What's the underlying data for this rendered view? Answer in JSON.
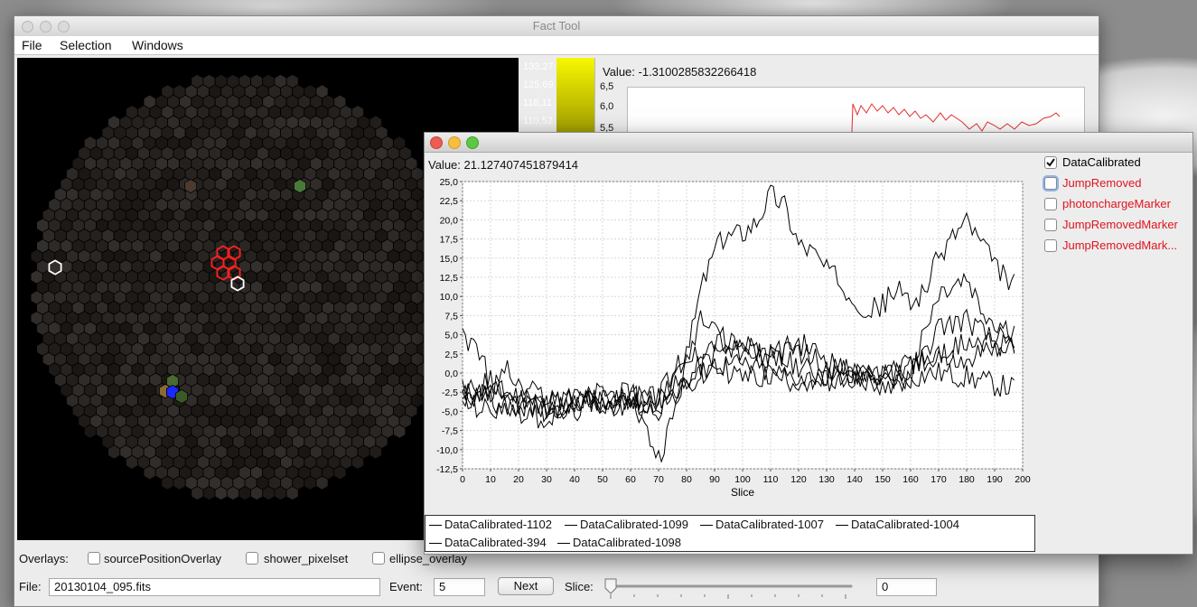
{
  "main_window": {
    "title": "Fact Tool",
    "menu": [
      "File",
      "Selection",
      "Windows"
    ],
    "color_scale_labels": [
      "133,27",
      "125,69",
      "118,11",
      "110,52"
    ],
    "value_label": "Value: -1.3100285832266418",
    "bg_plot_yticks": [
      "6,5",
      "6,0",
      "5,5"
    ],
    "overlays_label": "Overlays:",
    "overlays": [
      {
        "label": "sourcePositionOverlay",
        "checked": false
      },
      {
        "label": "shower_pixelset",
        "checked": false
      },
      {
        "label": "ellipse_overlay",
        "checked": false
      }
    ],
    "file_label": "File:",
    "file_value": "20130104_095.fits",
    "event_label": "Event:",
    "event_value": "5",
    "next_label": "Next",
    "slice_label": "Slice:",
    "slice_value": "0"
  },
  "plot_window": {
    "value_label": "Value: 21.127407451879414",
    "series_toggles": [
      {
        "label": "DataCalibrated",
        "checked": true,
        "color": "#000000"
      },
      {
        "label": "JumpRemoved",
        "checked": false,
        "color": "#e0141e"
      },
      {
        "label": "photonchargeMarker",
        "checked": false,
        "color": "#e0141e"
      },
      {
        "label": "JumpRemovedMarker",
        "checked": false,
        "color": "#e0141e"
      },
      {
        "label": "JumpRemovedMark...",
        "checked": false,
        "color": "#e0141e"
      }
    ]
  },
  "chart_data": {
    "type": "line",
    "xlabel": "Slice",
    "ylabel": "",
    "xlim": [
      0,
      200
    ],
    "ylim": [
      -12.5,
      25
    ],
    "xticks": [
      0,
      10,
      20,
      30,
      40,
      50,
      60,
      70,
      80,
      90,
      100,
      110,
      120,
      130,
      140,
      150,
      160,
      170,
      180,
      190,
      200
    ],
    "yticks": [
      "25,0",
      "22,5",
      "20,0",
      "17,5",
      "15,0",
      "12,5",
      "10,0",
      "7,5",
      "5,0",
      "2,5",
      "0,0",
      "-2,5",
      "-5,0",
      "-7,5",
      "-10,0",
      "-12,5"
    ],
    "grid": true,
    "legend_position": "bottom",
    "series": [
      {
        "name": "DataCalibrated-1102",
        "anchors": [
          [
            0,
            -3
          ],
          [
            10,
            -2.5
          ],
          [
            20,
            -3
          ],
          [
            30,
            -4
          ],
          [
            40,
            -3
          ],
          [
            50,
            -4
          ],
          [
            60,
            -3
          ],
          [
            70,
            -3.5
          ],
          [
            75,
            -2
          ],
          [
            80,
            -1
          ],
          [
            85,
            1
          ],
          [
            90,
            2.5
          ],
          [
            100,
            3
          ],
          [
            110,
            2
          ],
          [
            120,
            1
          ],
          [
            130,
            -0.5
          ],
          [
            140,
            -1
          ],
          [
            150,
            -1.5
          ],
          [
            160,
            -0.5
          ],
          [
            170,
            0
          ],
          [
            180,
            -0.5
          ],
          [
            190,
            -1.5
          ],
          [
            197,
            -2
          ]
        ]
      },
      {
        "name": "DataCalibrated-1099",
        "anchors": [
          [
            0,
            -3
          ],
          [
            10,
            -1
          ],
          [
            20,
            -3.5
          ],
          [
            30,
            -4
          ],
          [
            40,
            -4
          ],
          [
            50,
            -2.5
          ],
          [
            60,
            -3
          ],
          [
            70,
            -11
          ],
          [
            75,
            -6
          ],
          [
            80,
            1
          ],
          [
            85,
            8
          ],
          [
            90,
            7
          ],
          [
            95,
            3
          ],
          [
            100,
            4
          ],
          [
            110,
            2.5
          ],
          [
            120,
            4
          ],
          [
            130,
            2
          ],
          [
            140,
            -1
          ],
          [
            150,
            -1.5
          ],
          [
            160,
            -1
          ],
          [
            170,
            6
          ],
          [
            180,
            7
          ],
          [
            190,
            4
          ],
          [
            197,
            3
          ]
        ]
      },
      {
        "name": "DataCalibrated-1007",
        "anchors": [
          [
            0,
            5
          ],
          [
            5,
            3
          ],
          [
            10,
            -1
          ],
          [
            20,
            -4
          ],
          [
            30,
            -5
          ],
          [
            40,
            -3.5
          ],
          [
            50,
            -4
          ],
          [
            60,
            -4
          ],
          [
            70,
            -3.5
          ],
          [
            80,
            -1.5
          ],
          [
            90,
            1
          ],
          [
            100,
            1
          ],
          [
            110,
            0
          ],
          [
            120,
            -0.5
          ],
          [
            130,
            -1
          ],
          [
            140,
            -0.5
          ],
          [
            150,
            0
          ],
          [
            160,
            1
          ],
          [
            170,
            2.5
          ],
          [
            180,
            1
          ],
          [
            190,
            5
          ],
          [
            197,
            3.5
          ]
        ]
      },
      {
        "name": "DataCalibrated-1004",
        "anchors": [
          [
            0,
            -4
          ],
          [
            10,
            -5
          ],
          [
            20,
            -4
          ],
          [
            30,
            -5
          ],
          [
            40,
            -3.5
          ],
          [
            50,
            -4
          ],
          [
            60,
            -4
          ],
          [
            70,
            -5
          ],
          [
            75,
            -1
          ],
          [
            80,
            1
          ],
          [
            85,
            3
          ],
          [
            90,
            4
          ],
          [
            100,
            3.5
          ],
          [
            110,
            2
          ],
          [
            120,
            3
          ],
          [
            130,
            1
          ],
          [
            140,
            0
          ],
          [
            150,
            -0.5
          ],
          [
            160,
            0
          ],
          [
            170,
            10
          ],
          [
            180,
            12
          ],
          [
            185,
            8
          ],
          [
            190,
            6
          ],
          [
            197,
            5
          ]
        ]
      },
      {
        "name": "DataCalibrated-394",
        "anchors": [
          [
            0,
            -1
          ],
          [
            10,
            -3.5
          ],
          [
            20,
            -5
          ],
          [
            30,
            -6
          ],
          [
            40,
            -5
          ],
          [
            50,
            -4
          ],
          [
            60,
            -4
          ],
          [
            70,
            -4
          ],
          [
            80,
            -2
          ],
          [
            90,
            1
          ],
          [
            100,
            -0.5
          ],
          [
            110,
            -0.5
          ],
          [
            120,
            -1
          ],
          [
            130,
            -1
          ],
          [
            140,
            0
          ],
          [
            150,
            -0.5
          ],
          [
            160,
            1
          ],
          [
            170,
            2
          ],
          [
            180,
            4
          ],
          [
            190,
            3.5
          ],
          [
            197,
            3
          ]
        ]
      },
      {
        "name": "DataCalibrated-1098",
        "anchors": [
          [
            0,
            -3
          ],
          [
            10,
            -3
          ],
          [
            15,
            1
          ],
          [
            20,
            -2
          ],
          [
            30,
            -3
          ],
          [
            40,
            -4
          ],
          [
            50,
            -3.5
          ],
          [
            60,
            -3
          ],
          [
            70,
            -3
          ],
          [
            75,
            0
          ],
          [
            80,
            2
          ],
          [
            85,
            11
          ],
          [
            90,
            16
          ],
          [
            95,
            18
          ],
          [
            100,
            18.5
          ],
          [
            105,
            20
          ],
          [
            110,
            23.5
          ],
          [
            115,
            22
          ],
          [
            120,
            17
          ],
          [
            125,
            16
          ],
          [
            130,
            13.5
          ],
          [
            140,
            10
          ],
          [
            145,
            8
          ],
          [
            150,
            9
          ],
          [
            155,
            11
          ],
          [
            160,
            9
          ],
          [
            165,
            11
          ],
          [
            170,
            15
          ],
          [
            175,
            18
          ],
          [
            180,
            20
          ],
          [
            185,
            17
          ],
          [
            190,
            14
          ],
          [
            195,
            12
          ],
          [
            197,
            12
          ]
        ]
      }
    ]
  }
}
